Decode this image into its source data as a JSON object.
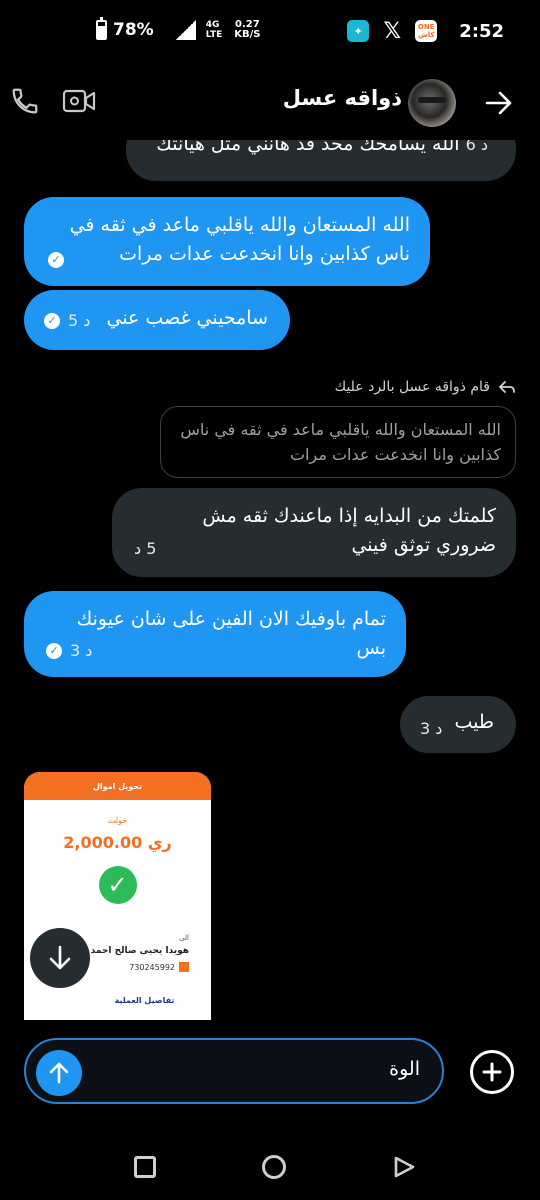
{
  "status_bar": {
    "battery_percent": "78%",
    "battery_level": 0.78,
    "network_top": "4G",
    "network_bottom": "LTE",
    "speed_value": "0.27",
    "speed_unit": "KB/S",
    "time": "2:52",
    "app_icons": [
      "ai-assistant-app-icon",
      "x-app-icon",
      "one-cash-app-icon"
    ],
    "one_cash_top": "ONE",
    "one_cash_bottom": "كاش"
  },
  "header": {
    "contact_name": "ذواقه عسل"
  },
  "messages": [
    {
      "side": "in",
      "text": "الله يسامحك محد قد هانني مثل هيانتك",
      "time": "6 د"
    },
    {
      "side": "out",
      "text": "الله المستعان والله ياقلبي ماعد في ثقه في ناس كذابين وانا انخدعت عدات مرات",
      "time": ""
    },
    {
      "side": "out",
      "text": "سامحيني غصب عني",
      "time": "5 د"
    },
    {
      "side": "in",
      "text": "كلمتك من البدايه إذا ماعندك ثقه مش ضروري توثق فيني",
      "time": "5 د"
    },
    {
      "side": "out",
      "text": "تمام باوفيك الان الفين على شان عيونك بس",
      "time": "3 د"
    },
    {
      "side": "in",
      "text": "طيب",
      "time": "3 د"
    }
  ],
  "reply": {
    "label": "قام ذواقه عسل بالرد عليك",
    "quoted_text": "الله المستعان والله ياقلبي ماعد في ثقه في ناس كذابين وانا انخدعت عدات مرات"
  },
  "receipt": {
    "title": "تحويل اموال",
    "subtitle": "حولت",
    "amount": "2,000.00 ري",
    "to_label": "الى",
    "recipient": "هويدا يحيى صالح احمد ع",
    "number": "730245992",
    "details_link": "تفاصيل العملية"
  },
  "composer": {
    "input_value": "الوة"
  },
  "colors": {
    "outgoing_bubble": "#1f96f1",
    "incoming_bubble": "#262d31",
    "receipt_accent": "#f36f21"
  }
}
